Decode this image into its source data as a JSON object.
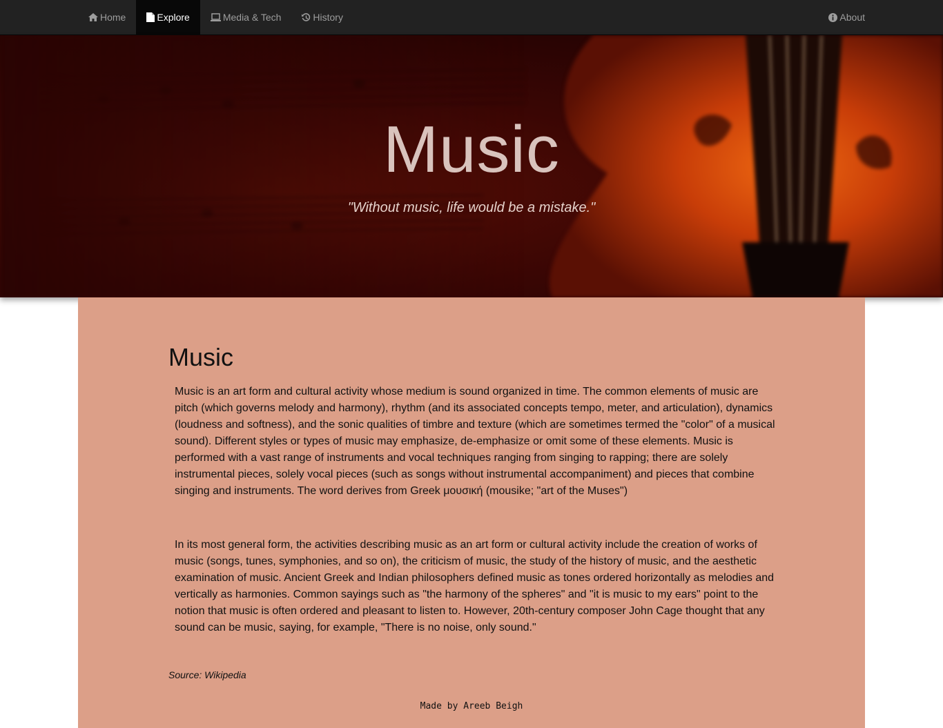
{
  "nav": {
    "items": [
      {
        "label": "Home",
        "icon": "home-icon",
        "active": false
      },
      {
        "label": "Explore",
        "icon": "file-icon",
        "active": true
      },
      {
        "label": "Media & Tech",
        "icon": "laptop-icon",
        "active": false
      },
      {
        "label": "History",
        "icon": "history-icon",
        "active": false
      }
    ],
    "about": {
      "label": "About",
      "icon": "info-icon"
    }
  },
  "hero": {
    "title": "Music",
    "quote": "\"Without music, life would be a mistake.\""
  },
  "article": {
    "heading": "Music",
    "paragraphs": [
      "Music is an art form and cultural activity whose medium is sound organized in time. The common elements of music are pitch (which governs melody and harmony), rhythm (and its associated concepts tempo, meter, and articulation), dynamics (loudness and softness), and the sonic qualities of timbre and texture (which are sometimes termed the \"color\" of a musical sound). Different styles or types of music may emphasize, de-emphasize or omit some of these elements. Music is performed with a vast range of instruments and vocal techniques ranging from singing to rapping; there are solely instrumental pieces, solely vocal pieces (such as songs without instrumental accompaniment) and pieces that combine singing and instruments. The word derives from Greek μουσική (mousike; \"art of the Muses\")",
      "In its most general form, the activities describing music as an art form or cultural activity include the creation of works of music (songs, tunes, symphonies, and so on), the criticism of music, the study of the history of music, and the aesthetic examination of music. Ancient Greek and Indian philosophers defined music as tones ordered horizontally as melodies and vertically as harmonies. Common sayings such as \"the harmony of the spheres\" and \"it is music to my ears\" point to the notion that music is often ordered and pleasant to listen to. However, 20th-century composer John Cage thought that any sound can be music, saying, for example, \"There is no noise, only sound.\""
    ],
    "source_label": "Source: ",
    "source_name": "Wikipedia"
  },
  "footer": {
    "text": "Made by Areeb Beigh"
  },
  "colors": {
    "navbar": "#222222",
    "nav_active": "#080808",
    "nav_text": "#9d9d9d",
    "content_bg": "#dc9f88",
    "hero_title": "#d9c3bd"
  }
}
